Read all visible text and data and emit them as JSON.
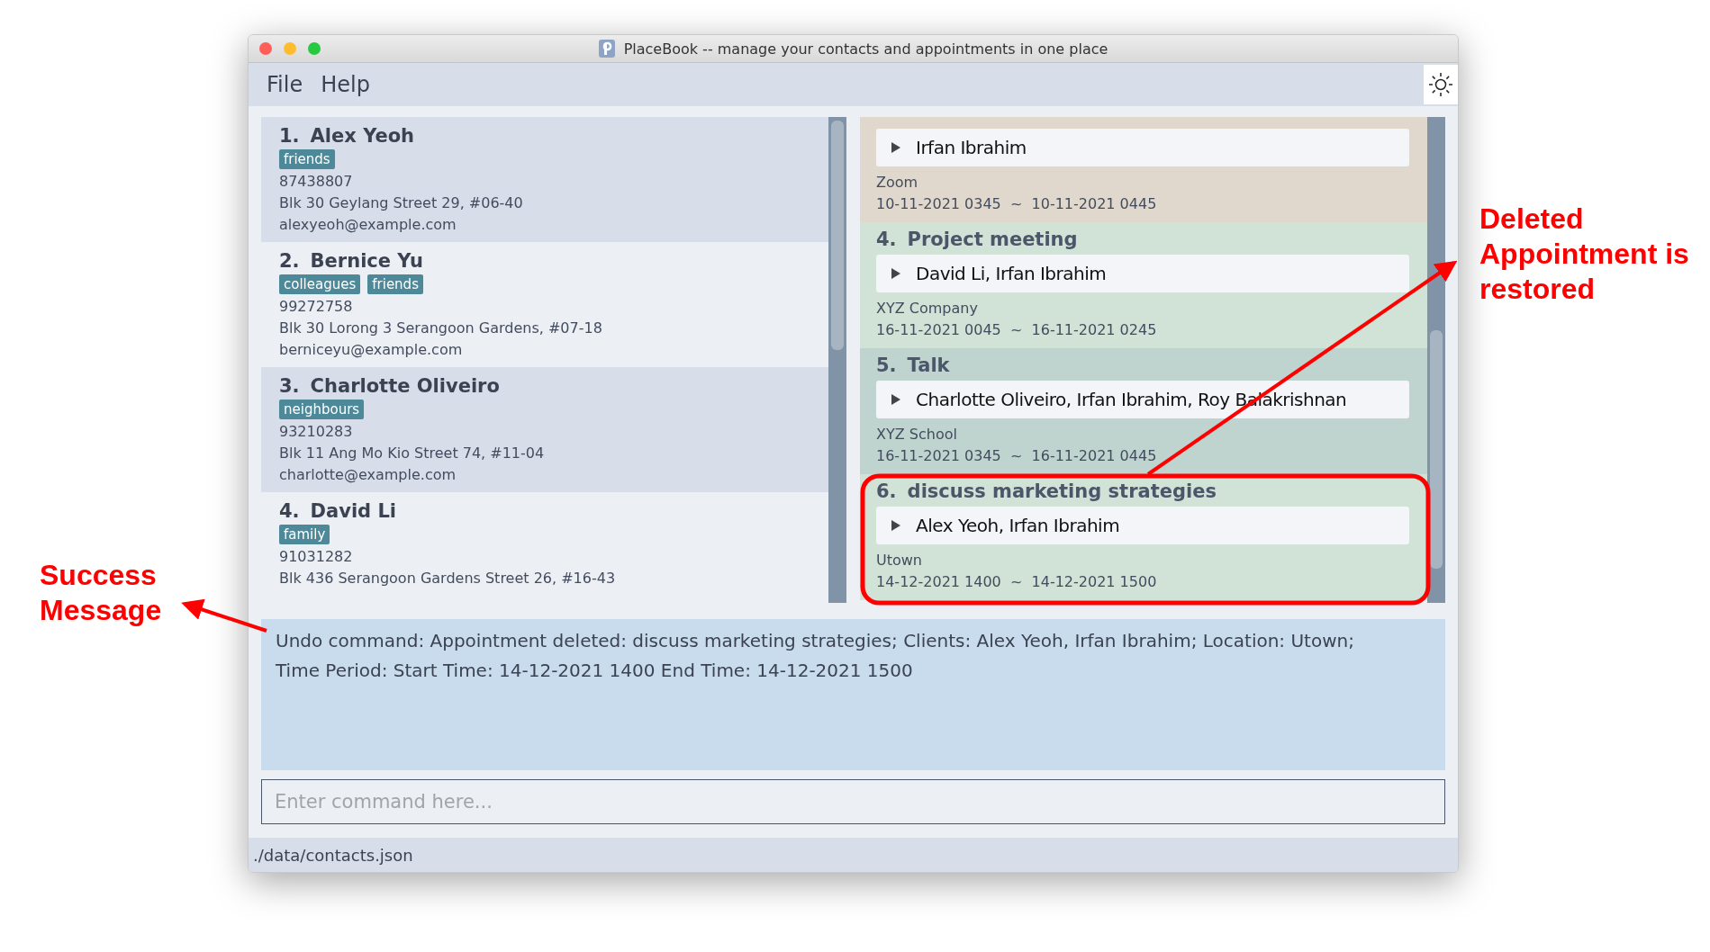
{
  "window": {
    "title": "PlaceBook -- manage your contacts and appointments in one place"
  },
  "menu": [
    {
      "label": "File"
    },
    {
      "label": "Help"
    }
  ],
  "contacts": [
    {
      "index": "1.",
      "name": "Alex Yeoh",
      "tags": [
        "friends"
      ],
      "phone": "87438807",
      "address": "Blk 30 Geylang Street 29, #06-40",
      "email": "alexyeoh@example.com"
    },
    {
      "index": "2.",
      "name": "Bernice Yu",
      "tags": [
        "colleagues",
        "friends"
      ],
      "phone": "99272758",
      "address": "Blk 30 Lorong 3 Serangoon Gardens, #07-18",
      "email": "berniceyu@example.com"
    },
    {
      "index": "3.",
      "name": "Charlotte Oliveiro",
      "tags": [
        "neighbours"
      ],
      "phone": "93210283",
      "address": "Blk 11 Ang Mo Kio Street 74, #11-04",
      "email": "charlotte@example.com"
    },
    {
      "index": "4.",
      "name": "David Li",
      "tags": [
        "family"
      ],
      "phone": "91031282",
      "address": "Blk 436 Serangoon Gardens Street 26, #16-43"
    }
  ],
  "appointments": [
    {
      "color": "#e0d8cc",
      "clients": "Irfan Ibrahim",
      "expanded": false,
      "location": "Zoom",
      "time": "10-11-2021 0345  ~  10-11-2021 0445"
    },
    {
      "index": "4.",
      "title": "Project meeting",
      "color": "#d1e2d6",
      "clients": "David Li, Irfan Ibrahim",
      "expanded": false,
      "location": "XYZ Company",
      "time": "16-11-2021 0045  ~  16-11-2021 0245"
    },
    {
      "index": "5.",
      "title": "Talk",
      "color": "#bfd4cf",
      "clients": "Charlotte Oliveiro, Irfan Ibrahim, Roy Balakrishnan",
      "expanded": false,
      "location": "XYZ School",
      "time": "16-11-2021 0345  ~  16-11-2021 0445"
    },
    {
      "index": "6.",
      "title": "discuss marketing strategies",
      "color": "#d1e2d6",
      "clients": "Alex Yeoh, Irfan Ibrahim",
      "expanded": false,
      "location": "Utown",
      "time": "14-12-2021 1400  ~  14-12-2021 1500"
    }
  ],
  "result": "Undo command: Appointment deleted: discuss marketing strategies; Clients: Alex Yeoh, Irfan Ibrahim; Location: Utown; Time Period: Start Time: 14-12-2021 1400 End Time: 14-12-2021 1500",
  "command": {
    "placeholder": "Enter command here..."
  },
  "status_bar": "./data/contacts.json",
  "annotations": [
    {
      "kind": "success",
      "text": "Success Message"
    },
    {
      "kind": "restored",
      "text": "Deleted Appointment is restored"
    }
  ]
}
